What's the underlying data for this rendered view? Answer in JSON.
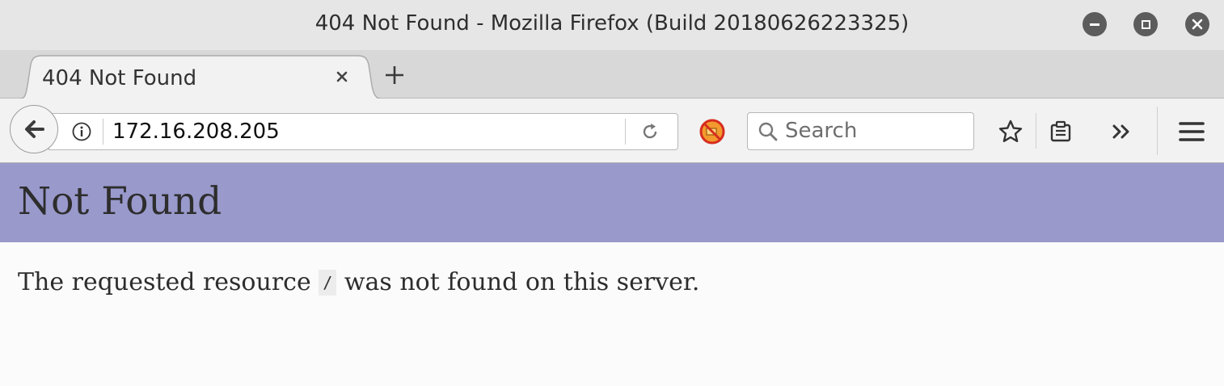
{
  "window": {
    "title": "404 Not Found - Mozilla Firefox (Build 20180626223325)",
    "controls": [
      "minimize-icon",
      "maximize-icon",
      "close-icon"
    ]
  },
  "tabs": [
    {
      "label": "404 Not Found",
      "active": true
    }
  ],
  "navbar": {
    "url": "172.16.208.205",
    "search_placeholder": "Search"
  },
  "page": {
    "header_bg": "#9999cc",
    "title": "Not Found",
    "message_before": "The requested resource ",
    "resource_path": "/",
    "message_after": " was not found on this server."
  }
}
